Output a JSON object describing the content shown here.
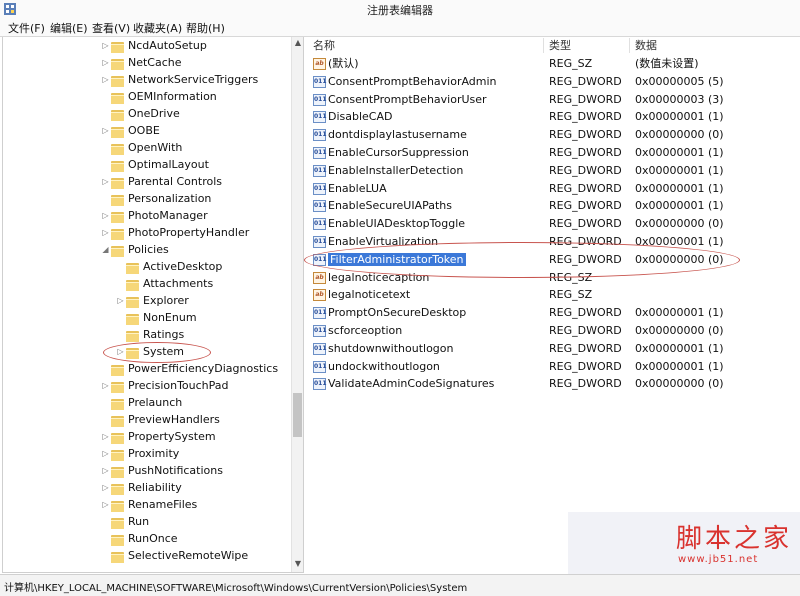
{
  "window": {
    "title": "注册表编辑器"
  },
  "menu": [
    "文件(F)",
    "编辑(E)",
    "查看(V)",
    "收藏夹(A)",
    "帮助(H)"
  ],
  "tree": [
    {
      "label": "NcdAutoSetup",
      "indent": 0,
      "arrow": "▷"
    },
    {
      "label": "NetCache",
      "indent": 0,
      "arrow": "▷"
    },
    {
      "label": "NetworkServiceTriggers",
      "indent": 0,
      "arrow": "▷"
    },
    {
      "label": "OEMInformation",
      "indent": 0,
      "arrow": ""
    },
    {
      "label": "OneDrive",
      "indent": 0,
      "arrow": ""
    },
    {
      "label": "OOBE",
      "indent": 0,
      "arrow": "▷"
    },
    {
      "label": "OpenWith",
      "indent": 0,
      "arrow": ""
    },
    {
      "label": "OptimalLayout",
      "indent": 0,
      "arrow": ""
    },
    {
      "label": "Parental Controls",
      "indent": 0,
      "arrow": "▷"
    },
    {
      "label": "Personalization",
      "indent": 0,
      "arrow": ""
    },
    {
      "label": "PhotoManager",
      "indent": 0,
      "arrow": "▷"
    },
    {
      "label": "PhotoPropertyHandler",
      "indent": 0,
      "arrow": "▷"
    },
    {
      "label": "Policies",
      "indent": 0,
      "arrow": "◢"
    },
    {
      "label": "ActiveDesktop",
      "indent": 1,
      "arrow": ""
    },
    {
      "label": "Attachments",
      "indent": 1,
      "arrow": ""
    },
    {
      "label": "Explorer",
      "indent": 1,
      "arrow": "▷"
    },
    {
      "label": "NonEnum",
      "indent": 1,
      "arrow": ""
    },
    {
      "label": "Ratings",
      "indent": 1,
      "arrow": ""
    },
    {
      "label": "System",
      "indent": 1,
      "arrow": "▷"
    },
    {
      "label": "PowerEfficiencyDiagnostics",
      "indent": 0,
      "arrow": ""
    },
    {
      "label": "PrecisionTouchPad",
      "indent": 0,
      "arrow": "▷"
    },
    {
      "label": "Prelaunch",
      "indent": 0,
      "arrow": ""
    },
    {
      "label": "PreviewHandlers",
      "indent": 0,
      "arrow": ""
    },
    {
      "label": "PropertySystem",
      "indent": 0,
      "arrow": "▷"
    },
    {
      "label": "Proximity",
      "indent": 0,
      "arrow": "▷"
    },
    {
      "label": "PushNotifications",
      "indent": 0,
      "arrow": "▷"
    },
    {
      "label": "Reliability",
      "indent": 0,
      "arrow": "▷"
    },
    {
      "label": "RenameFiles",
      "indent": 0,
      "arrow": "▷"
    },
    {
      "label": "Run",
      "indent": 0,
      "arrow": ""
    },
    {
      "label": "RunOnce",
      "indent": 0,
      "arrow": ""
    },
    {
      "label": "SelectiveRemoteWipe",
      "indent": 0,
      "arrow": ""
    }
  ],
  "list": {
    "headers": [
      "名称",
      "类型",
      "数据"
    ],
    "rows": [
      {
        "name": "(默认)",
        "kind": "sz",
        "type": "REG_SZ",
        "data": "(数值未设置)"
      },
      {
        "name": "ConsentPromptBehaviorAdmin",
        "kind": "dw",
        "type": "REG_DWORD",
        "data": "0x00000005 (5)"
      },
      {
        "name": "ConsentPromptBehaviorUser",
        "kind": "dw",
        "type": "REG_DWORD",
        "data": "0x00000003 (3)"
      },
      {
        "name": "DisableCAD",
        "kind": "dw",
        "type": "REG_DWORD",
        "data": "0x00000001 (1)"
      },
      {
        "name": "dontdisplaylastusername",
        "kind": "dw",
        "type": "REG_DWORD",
        "data": "0x00000000 (0)"
      },
      {
        "name": "EnableCursorSuppression",
        "kind": "dw",
        "type": "REG_DWORD",
        "data": "0x00000001 (1)"
      },
      {
        "name": "EnableInstallerDetection",
        "kind": "dw",
        "type": "REG_DWORD",
        "data": "0x00000001 (1)"
      },
      {
        "name": "EnableLUA",
        "kind": "dw",
        "type": "REG_DWORD",
        "data": "0x00000001 (1)"
      },
      {
        "name": "EnableSecureUIAPaths",
        "kind": "dw",
        "type": "REG_DWORD",
        "data": "0x00000001 (1)"
      },
      {
        "name": "EnableUIADesktopToggle",
        "kind": "dw",
        "type": "REG_DWORD",
        "data": "0x00000000 (0)"
      },
      {
        "name": "EnableVirtualization",
        "kind": "dw",
        "type": "REG_DWORD",
        "data": "0x00000001 (1)"
      },
      {
        "name": "FilterAdministratorToken",
        "kind": "dw",
        "type": "REG_DWORD",
        "data": "0x00000000 (0)",
        "selected": true
      },
      {
        "name": "legalnoticecaption",
        "kind": "sz",
        "type": "REG_SZ",
        "data": ""
      },
      {
        "name": "legalnoticetext",
        "kind": "sz",
        "type": "REG_SZ",
        "data": ""
      },
      {
        "name": "PromptOnSecureDesktop",
        "kind": "dw",
        "type": "REG_DWORD",
        "data": "0x00000001 (1)"
      },
      {
        "name": "scforceoption",
        "kind": "dw",
        "type": "REG_DWORD",
        "data": "0x00000000 (0)"
      },
      {
        "name": "shutdownwithoutlogon",
        "kind": "dw",
        "type": "REG_DWORD",
        "data": "0x00000001 (1)"
      },
      {
        "name": "undockwithoutlogon",
        "kind": "dw",
        "type": "REG_DWORD",
        "data": "0x00000001 (1)"
      },
      {
        "name": "ValidateAdminCodeSignatures",
        "kind": "dw",
        "type": "REG_DWORD",
        "data": "0x00000000 (0)"
      }
    ]
  },
  "status": {
    "path": "计算机\\HKEY_LOCAL_MACHINE\\SOFTWARE\\Microsoft\\Windows\\CurrentVersion\\Policies\\System"
  },
  "watermark": {
    "brand": "脚本之家",
    "url": "www.jb51.net"
  },
  "colors": {
    "selection": "#3b78d8",
    "annotation": "#c8554f",
    "folder": "#f6d779"
  }
}
